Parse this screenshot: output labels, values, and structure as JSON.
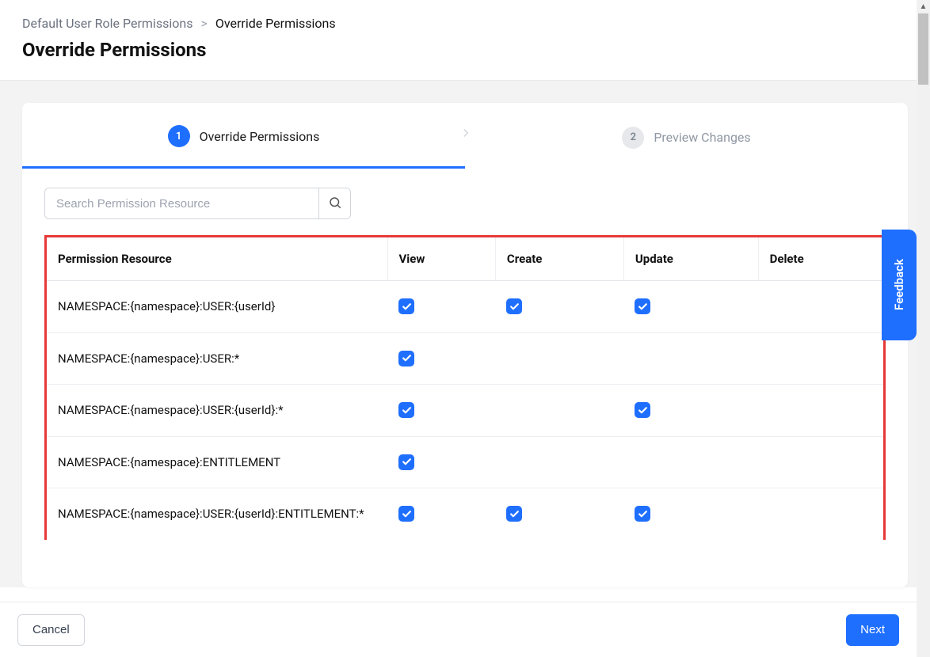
{
  "breadcrumb": {
    "parent": "Default User Role Permissions",
    "current": "Override Permissions"
  },
  "page_title": "Override Permissions",
  "steps": {
    "s1": {
      "num": "1",
      "label": "Override Permissions"
    },
    "s2": {
      "num": "2",
      "label": "Preview Changes"
    }
  },
  "search": {
    "placeholder": "Search Permission Resource",
    "value": ""
  },
  "columns": {
    "resource": "Permission Resource",
    "view": "View",
    "create": "Create",
    "update": "Update",
    "delete": "Delete"
  },
  "rows": [
    {
      "resource": "NAMESPACE:{namespace}:USER:{userId}",
      "view": true,
      "create": true,
      "update": true,
      "delete": false
    },
    {
      "resource": "NAMESPACE:{namespace}:USER:*",
      "view": true,
      "create": false,
      "update": false,
      "delete": false
    },
    {
      "resource": "NAMESPACE:{namespace}:USER:{userId}:*",
      "view": true,
      "create": false,
      "update": true,
      "delete": false
    },
    {
      "resource": "NAMESPACE:{namespace}:ENTITLEMENT",
      "view": true,
      "create": false,
      "update": false,
      "delete": false
    },
    {
      "resource": "NAMESPACE:{namespace}:USER:{userId}:ENTITLEMENT:*",
      "view": true,
      "create": true,
      "update": true,
      "delete": false
    }
  ],
  "footer": {
    "cancel": "Cancel",
    "next": "Next"
  },
  "feedback_label": "Feedback"
}
